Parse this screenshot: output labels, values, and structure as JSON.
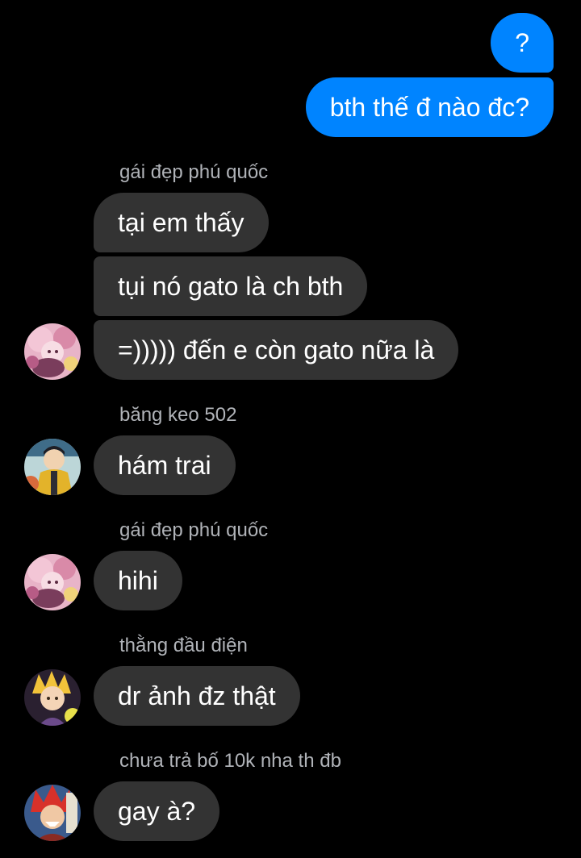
{
  "outgoing": [
    {
      "text": "?"
    },
    {
      "text": "bth thế đ nào đc?"
    }
  ],
  "groups": [
    {
      "sender": "gái đẹp phú quốc",
      "avatar": "anime-girl-pink-hair-avatar",
      "messages": [
        "tại em thấy",
        "tụi nó gato là ch bth",
        "=))))) đến e còn gato nữa là"
      ]
    },
    {
      "sender": "băng keo 502",
      "avatar": "anime-boy-yellow-jacket-avatar",
      "messages": [
        "hám trai"
      ]
    },
    {
      "sender": "gái đẹp phú quốc",
      "avatar": "anime-girl-pink-hair-avatar",
      "messages": [
        "hihi"
      ]
    },
    {
      "sender": "thằng đầu điện",
      "avatar": "anime-boy-blonde-avatar",
      "messages": [
        "dr ảnh đz thật"
      ]
    },
    {
      "sender": "chưa trả bố 10k nha th đb",
      "avatar": "anime-boy-red-hair-avatar",
      "messages": [
        "gay à?"
      ]
    }
  ],
  "colors": {
    "background": "#000000",
    "outgoing_bubble": "#0084ff",
    "incoming_bubble": "#333333",
    "sender_name": "#b0b3b8",
    "text": "#ffffff"
  }
}
